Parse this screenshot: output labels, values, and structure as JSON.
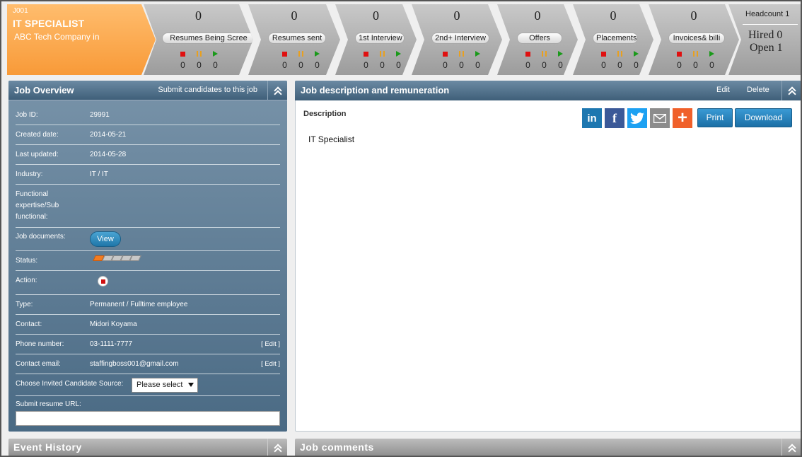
{
  "job": {
    "code": "J001",
    "title": "IT SPECIALIST",
    "company": "ABC Tech Company in"
  },
  "pipeline": [
    {
      "label": "Resumes Being Scree",
      "count": "0",
      "stopped": "0",
      "paused": "0",
      "active": "0"
    },
    {
      "label": "Resumes sent",
      "count": "0",
      "stopped": "0",
      "paused": "0",
      "active": "0"
    },
    {
      "label": "1st Interview",
      "count": "0",
      "stopped": "0",
      "paused": "0",
      "active": "0"
    },
    {
      "label": "2nd+ Interview",
      "count": "0",
      "stopped": "0",
      "paused": "0",
      "active": "0"
    },
    {
      "label": "Offers",
      "count": "0",
      "stopped": "0",
      "paused": "0",
      "active": "0"
    },
    {
      "label": "Placements",
      "count": "0",
      "stopped": "0",
      "paused": "0",
      "active": "0"
    },
    {
      "label": "Invoices& billi",
      "count": "0",
      "stopped": "0",
      "paused": "0",
      "active": "0"
    }
  ],
  "summary": {
    "headcount": "Headcount 1",
    "hired": "Hired 0",
    "open": "Open 1"
  },
  "overview": {
    "title": "Job Overview",
    "submit_link": "Submit candidates to this job",
    "job_id_label": "Job ID:",
    "job_id": "29991",
    "created_label": "Created date:",
    "created": "2014-05-21",
    "updated_label": "Last updated:",
    "updated": "2014-05-28",
    "industry_label": "Industry:",
    "industry": "IT / IT",
    "functional_label_1": "Functional",
    "functional_label_2": "expertise/Sub",
    "functional_label_3": "functional:",
    "documents_label": "Job documents:",
    "view_button": "View",
    "status_label": "Status:",
    "status_steps": 5,
    "status_active": 1,
    "action_label": "Action:",
    "type_label": "Type:",
    "type": "Permanent / Fulltime employee",
    "contact_label": "Contact:",
    "contact": "Midori Koyama",
    "phone_label": "Phone number:",
    "phone": "03-1111-7777",
    "email_label": "Contact email:",
    "email": "staffingboss001@gmail.com",
    "edit_link": "[ Edit ]",
    "source_label": "Choose Invited Candidate Source:",
    "source_select": "Please select",
    "url_label": "Submit resume URL:",
    "url_value": ""
  },
  "description": {
    "title": "Job description and remuneration",
    "edit": "Edit",
    "delete": "Delete",
    "label": "Description",
    "text": "IT Specialist",
    "print": "Print",
    "download": "Download",
    "share_icons": [
      "linkedin-icon",
      "facebook-icon",
      "twitter-icon",
      "email-icon",
      "add-share-icon"
    ],
    "share_colors": {
      "linkedin": "#1d77b0",
      "facebook": "#3b5998",
      "twitter": "#1da1f2",
      "email": "#8c8c8c",
      "add": "#f0602a"
    }
  },
  "bottom": {
    "event_history": "Event History",
    "job_comments": "Job comments"
  },
  "colors": {
    "accent_orange": "#f89a38",
    "panel_blue": "#4a6a84",
    "button_blue": "#1b6fa6"
  }
}
